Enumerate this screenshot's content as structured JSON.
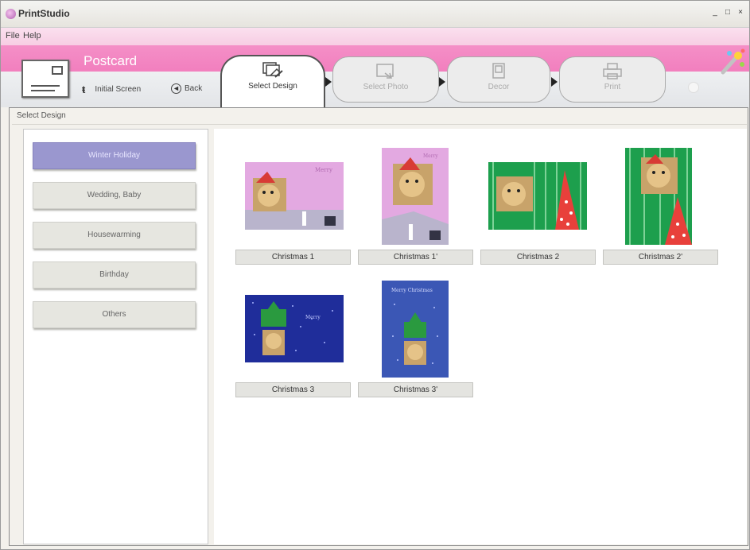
{
  "window": {
    "title": "PrintStudio",
    "controls": [
      "_",
      "□",
      "×"
    ]
  },
  "menu": [
    "File",
    "Help"
  ],
  "header": {
    "section_title": "Postcard",
    "nav": {
      "initial_screen": "Initial Screen",
      "back": "Back"
    },
    "steps": [
      {
        "label": "Select Design",
        "active": true
      },
      {
        "label": "Select Photo",
        "active": false
      },
      {
        "label": "Decor",
        "active": false
      },
      {
        "label": "Print",
        "active": false
      }
    ]
  },
  "panel": {
    "label": "Select Design"
  },
  "categories": [
    {
      "label": "Winter Holiday",
      "active": true
    },
    {
      "label": "Wedding, Baby",
      "active": false
    },
    {
      "label": "Housewarming",
      "active": false
    },
    {
      "label": "Birthday",
      "active": false
    },
    {
      "label": "Others",
      "active": false
    }
  ],
  "designs": [
    {
      "label": "Christmas 1",
      "style": "pink",
      "orientation": "landscape"
    },
    {
      "label": "Christmas 1'",
      "style": "pink",
      "orientation": "portrait"
    },
    {
      "label": "Christmas 2",
      "style": "green",
      "orientation": "landscape"
    },
    {
      "label": "Christmas 2'",
      "style": "green",
      "orientation": "portrait"
    },
    {
      "label": "Christmas 3",
      "style": "navy",
      "orientation": "landscape"
    },
    {
      "label": "Christmas 3'",
      "style": "blue",
      "orientation": "portrait"
    }
  ],
  "colors": {
    "header_pink": "#f27fbe",
    "menu_pink": "#f7cde3",
    "active_category": "#9a97cf",
    "card_pink": "#e3a9e1",
    "card_green": "#1d9f4d",
    "card_navy": "#1f2d9a",
    "card_blue": "#3b57b5"
  }
}
